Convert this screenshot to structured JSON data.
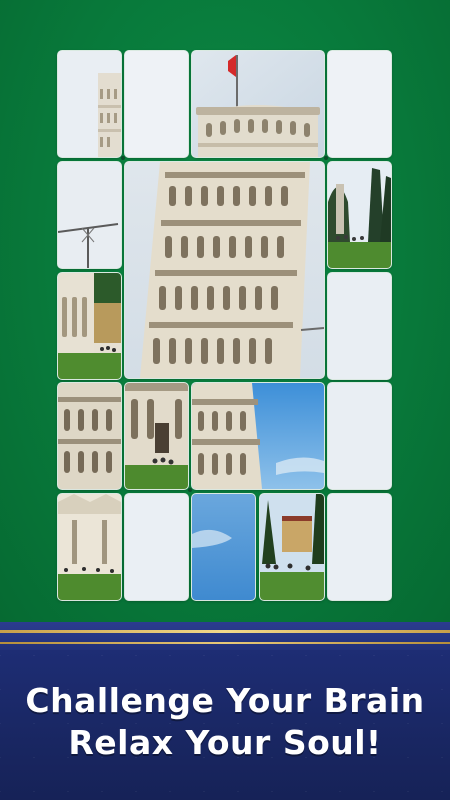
{
  "puzzle": {
    "image_subject": "Leaning Tower of Pisa",
    "flag_color": "#d42a2a",
    "felt_color": "#0a7d3e"
  },
  "banner": {
    "line1": "Challenge Your Brain",
    "line2": "Relax Your Soul!",
    "background_color": "#1f2f7a",
    "trim_color": "#e0c070"
  }
}
